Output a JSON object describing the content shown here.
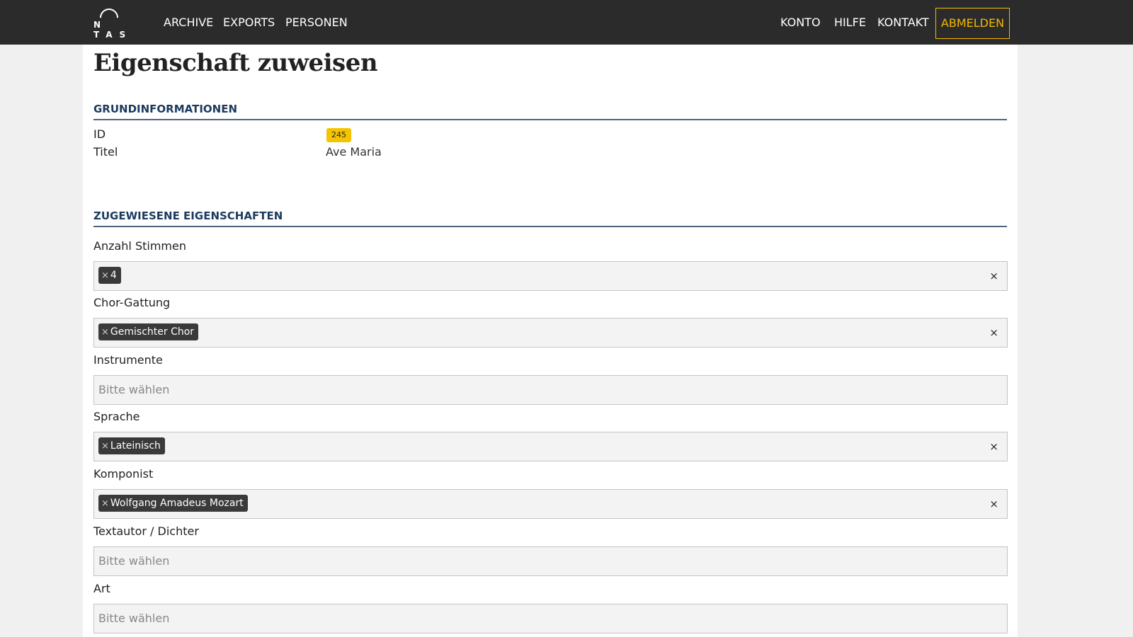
{
  "nav": {
    "logo_text": "N  TAS",
    "links": [
      "ARCHIVE",
      "EXPORTS",
      "PERSONEN"
    ],
    "right_links": [
      "KONTO",
      "HILFE",
      "KONTAKT"
    ],
    "logout": "ABMELDEN"
  },
  "page": {
    "title": "Eigenschaft zuweisen"
  },
  "grundinfo": {
    "title": "GRUNDINFORMATIONEN",
    "id_label": "ID",
    "id_value": "245",
    "titel_label": "Titel",
    "titel_value": "Ave Maria"
  },
  "eigenschaften": {
    "title": "ZUGEWIESENE EIGENSCHAFTEN",
    "fields": [
      {
        "label": "Anzahl Stimmen",
        "tag": "4",
        "placeholder": ""
      },
      {
        "label": "Chor-Gattung",
        "tag": "Gemischter Chor",
        "placeholder": ""
      },
      {
        "label": "Instrumente",
        "tag": "",
        "placeholder": "Bitte wählen"
      },
      {
        "label": "Sprache",
        "tag": "Lateinisch",
        "placeholder": ""
      },
      {
        "label": "Komponist",
        "tag": "Wolfgang Amadeus Mozart",
        "placeholder": ""
      },
      {
        "label": "Textautor / Dichter",
        "tag": "",
        "placeholder": "Bitte wählen"
      },
      {
        "label": "Art",
        "tag": "",
        "placeholder": "Bitte wählen"
      }
    ],
    "tag_remove": "×",
    "clear_all": "×"
  },
  "colors": {
    "accent": "#f5b800",
    "navbar": "#2b2b2b",
    "section_title": "#1c3a5e"
  }
}
